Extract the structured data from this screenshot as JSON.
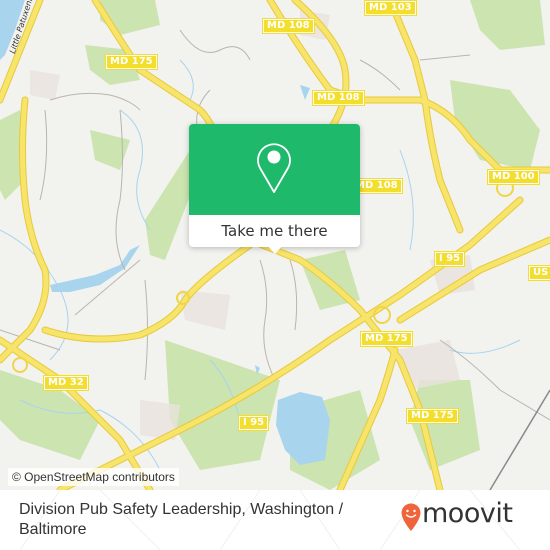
{
  "map": {
    "road_shields": [
      {
        "label": "MD 175",
        "id": "md175-nw"
      },
      {
        "label": "MD 108",
        "id": "md108-top"
      },
      {
        "label": "MD 103",
        "id": "md103"
      },
      {
        "label": "MD 108",
        "id": "md108-center"
      },
      {
        "label": "MD 108",
        "id": "md108-popup"
      },
      {
        "label": "MD 100",
        "id": "md100"
      },
      {
        "label": "I 95",
        "id": "i95-east"
      },
      {
        "label": "US",
        "id": "us-east"
      },
      {
        "label": "MD 175",
        "id": "md175-interchange"
      },
      {
        "label": "MD 32",
        "id": "md32"
      },
      {
        "label": "I 95",
        "id": "i95-south"
      },
      {
        "label": "MD 175",
        "id": "md175-south"
      }
    ],
    "river_label": "Little Patuxent",
    "colors": {
      "background": "#f2f2ef",
      "road": "#f5e05a",
      "road_casing": "#e8c93a",
      "water": "#a8d4ee",
      "park": "#c6e2a4",
      "minor_road": "#b9b4ae"
    }
  },
  "popup": {
    "icon": "map-pin-icon",
    "cta_label": "Take me there",
    "color": "#1fb96b"
  },
  "attribution": "© OpenStreetMap contributors",
  "footer": {
    "title": "Division Pub Safety Leadership, Washington / Baltimore",
    "logo_text": "moovit",
    "logo_color": "#f0643c"
  }
}
